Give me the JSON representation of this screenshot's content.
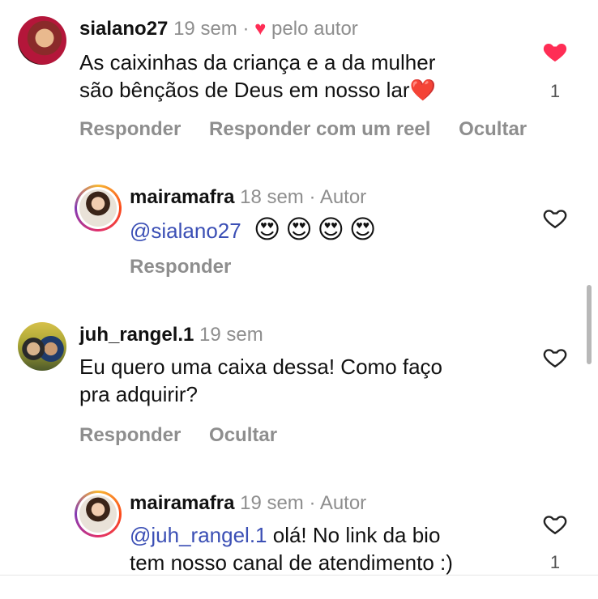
{
  "comments": [
    {
      "username": "sialano27",
      "time": "19 sem",
      "separator": "·",
      "badge_icon": "heart-icon",
      "badge_text": "pelo autor",
      "text_line1": "As caixinhas da criança e a da mulher",
      "text_line2": "são bênçãos  de Deus em nosso lar",
      "text_emoji": "❤️",
      "like_count": "1",
      "liked": true,
      "actions": [
        "Responder",
        "Responder com um reel",
        "Ocultar"
      ]
    },
    {
      "username": "mairamafra",
      "time": "18 sem",
      "separator": "·",
      "role": "Autor",
      "mention": "@sialano27",
      "emojis": [
        "😍",
        "😍",
        "😍",
        "😍"
      ],
      "liked": false,
      "actions": [
        "Responder"
      ]
    },
    {
      "username": "juh_rangel.1",
      "time": "19 sem",
      "text_line1": "Eu quero uma caixa dessa! Como faço",
      "text_line2": "pra adquirir?",
      "liked": false,
      "actions": [
        "Responder",
        "Ocultar"
      ]
    },
    {
      "username": "mairamafra",
      "time": "19 sem",
      "separator": "·",
      "role": "Autor",
      "mention": "@juh_rangel.1",
      "text_line1": " olá! No link da bio",
      "text_line2": "tem nosso canal de atendimento :)",
      "like_count": "1",
      "liked": false
    }
  ],
  "colors": {
    "like_red": "#ff2d55",
    "mention_blue": "#3b4fb5",
    "muted_gray": "#8e8e8e"
  }
}
